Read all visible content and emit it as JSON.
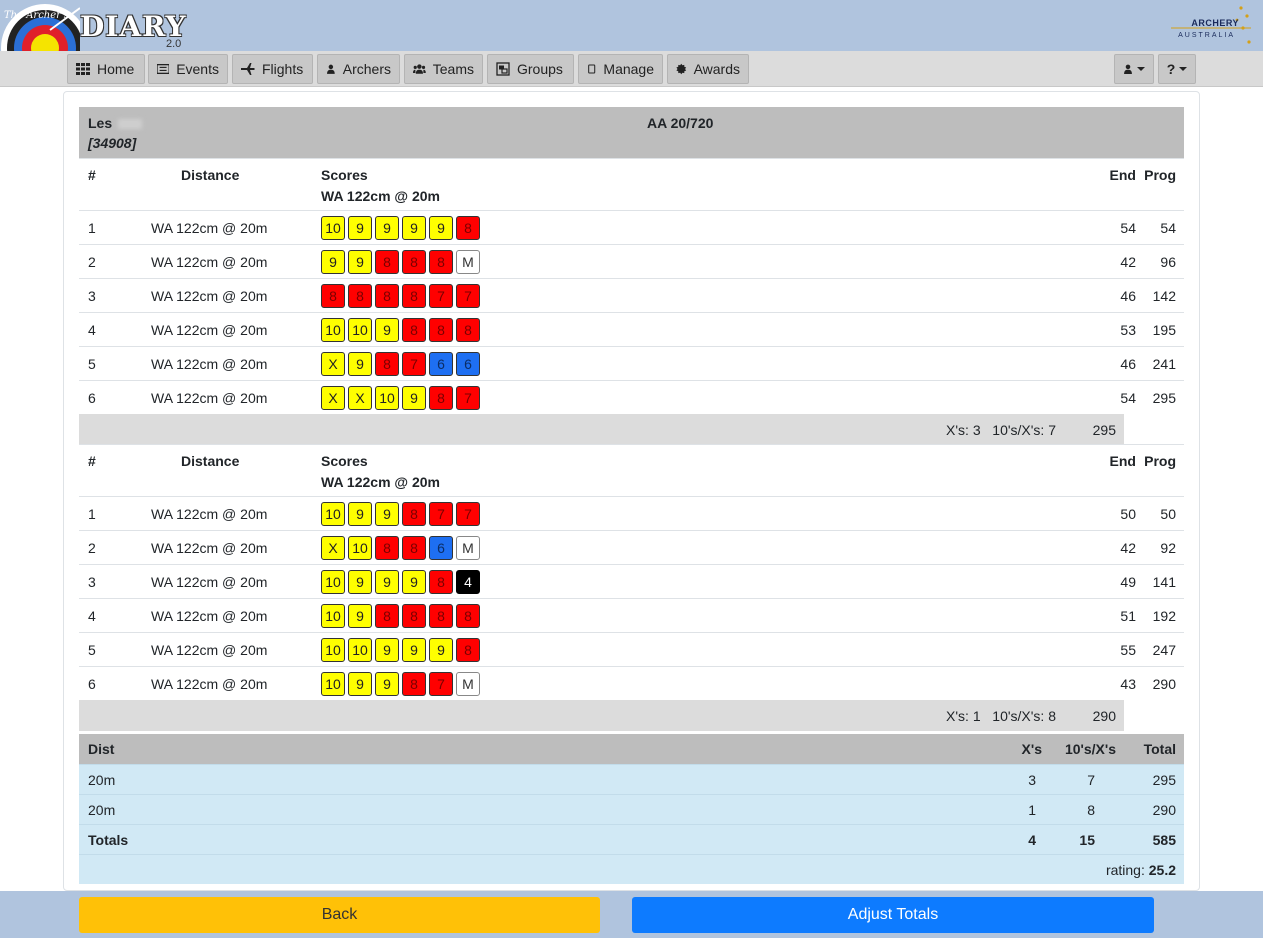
{
  "header": {
    "logo_top": "The Archer's",
    "logo_main": "DIARY",
    "logo_version": "2.0",
    "partner_top": "ARCHERY",
    "partner_bottom": "AUSTRALIA"
  },
  "nav": {
    "items": [
      {
        "label": "Home",
        "icon": "grid-icon"
      },
      {
        "label": "Events",
        "icon": "list-icon"
      },
      {
        "label": "Flights",
        "icon": "plane-icon"
      },
      {
        "label": "Archers",
        "icon": "user-icon"
      },
      {
        "label": "Teams",
        "icon": "users-icon"
      },
      {
        "label": "Groups",
        "icon": "object-group-icon"
      },
      {
        "label": "Manage",
        "icon": "square-icon"
      },
      {
        "label": "Awards",
        "icon": "certificate-icon"
      }
    ],
    "user_menu": "user-icon",
    "help_menu": "?"
  },
  "archer": {
    "name": "Les",
    "id": "[34908]",
    "round": "AA 20/720"
  },
  "table_headers": {
    "num": "#",
    "distance": "Distance",
    "scores": "Scores",
    "end": "End",
    "prog": "Prog"
  },
  "distances": [
    {
      "face": "WA 122cm @ 20m",
      "ends": [
        {
          "num": "1",
          "dist": "WA 122cm @ 20m",
          "arrows": [
            "10",
            "9",
            "9",
            "9",
            "9",
            "8"
          ],
          "end": "54",
          "prog": "54"
        },
        {
          "num": "2",
          "dist": "WA 122cm @ 20m",
          "arrows": [
            "9",
            "9",
            "8",
            "8",
            "8",
            "M"
          ],
          "end": "42",
          "prog": "96"
        },
        {
          "num": "3",
          "dist": "WA 122cm @ 20m",
          "arrows": [
            "8",
            "8",
            "8",
            "8",
            "7",
            "7"
          ],
          "end": "46",
          "prog": "142"
        },
        {
          "num": "4",
          "dist": "WA 122cm @ 20m",
          "arrows": [
            "10",
            "10",
            "9",
            "8",
            "8",
            "8"
          ],
          "end": "53",
          "prog": "195"
        },
        {
          "num": "5",
          "dist": "WA 122cm @ 20m",
          "arrows": [
            "X",
            "9",
            "8",
            "7",
            "6",
            "6"
          ],
          "end": "46",
          "prog": "241"
        },
        {
          "num": "6",
          "dist": "WA 122cm @ 20m",
          "arrows": [
            "X",
            "X",
            "10",
            "9",
            "8",
            "7"
          ],
          "end": "54",
          "prog": "295"
        }
      ],
      "subtotal": {
        "xs": "X's: 3",
        "tens": "10's/X's: 7",
        "total": "295"
      }
    },
    {
      "face": "WA 122cm @ 20m",
      "ends": [
        {
          "num": "1",
          "dist": "WA 122cm @ 20m",
          "arrows": [
            "10",
            "9",
            "9",
            "8",
            "7",
            "7"
          ],
          "end": "50",
          "prog": "50"
        },
        {
          "num": "2",
          "dist": "WA 122cm @ 20m",
          "arrows": [
            "X",
            "10",
            "8",
            "8",
            "6",
            "M"
          ],
          "end": "42",
          "prog": "92"
        },
        {
          "num": "3",
          "dist": "WA 122cm @ 20m",
          "arrows": [
            "10",
            "9",
            "9",
            "9",
            "8",
            "4"
          ],
          "end": "49",
          "prog": "141"
        },
        {
          "num": "4",
          "dist": "WA 122cm @ 20m",
          "arrows": [
            "10",
            "9",
            "8",
            "8",
            "8",
            "8"
          ],
          "end": "51",
          "prog": "192"
        },
        {
          "num": "5",
          "dist": "WA 122cm @ 20m",
          "arrows": [
            "10",
            "10",
            "9",
            "9",
            "9",
            "8"
          ],
          "end": "55",
          "prog": "247"
        },
        {
          "num": "6",
          "dist": "WA 122cm @ 20m",
          "arrows": [
            "10",
            "9",
            "9",
            "8",
            "7",
            "M"
          ],
          "end": "43",
          "prog": "290"
        }
      ],
      "subtotal": {
        "xs": "X's: 1",
        "tens": "10's/X's: 8",
        "total": "290"
      }
    }
  ],
  "summary": {
    "headers": {
      "dist": "Dist",
      "xs": "X's",
      "tens": "10's/X's",
      "total": "Total"
    },
    "rows": [
      {
        "dist": "20m",
        "xs": "3",
        "tens": "7",
        "total": "295"
      },
      {
        "dist": "20m",
        "xs": "1",
        "tens": "8",
        "total": "290"
      }
    ],
    "totals": {
      "label": "Totals",
      "xs": "4",
      "tens": "15",
      "total": "585"
    },
    "rating_label": "rating:",
    "rating_value": "25.2"
  },
  "footer": {
    "back_label": "Back",
    "adjust_label": "Adjust Totals"
  },
  "colors": {
    "gold": "#ffff00",
    "red": "#ff0000",
    "blue": "#1e6ff2",
    "black": "#000000",
    "miss": "#ffffff",
    "back_button": "#ffc107",
    "adjust_button": "#0d7bff"
  }
}
